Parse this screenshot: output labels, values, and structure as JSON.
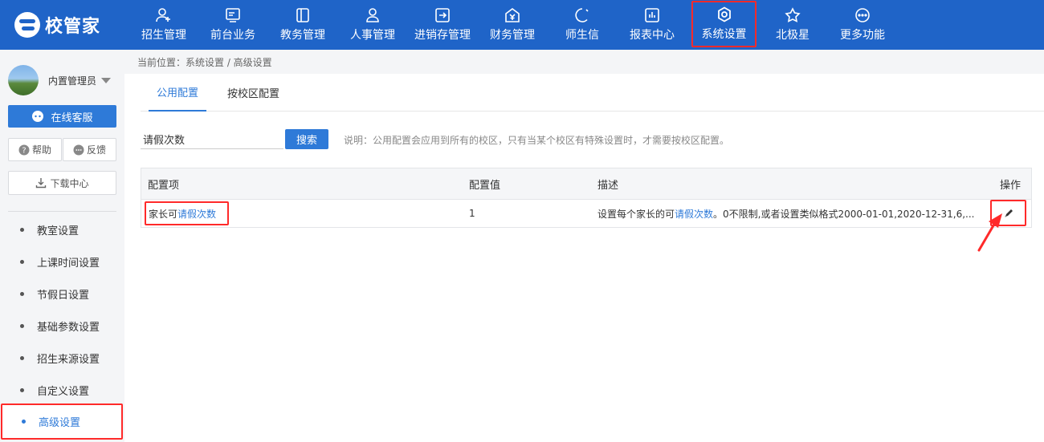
{
  "brand": {
    "name": "校管家"
  },
  "nav": [
    {
      "label": "招生管理",
      "icon": "user-add-icon"
    },
    {
      "label": "前台业务",
      "icon": "monitor-icon"
    },
    {
      "label": "教务管理",
      "icon": "book-icon"
    },
    {
      "label": "人事管理",
      "icon": "person-icon"
    },
    {
      "label": "进销存管理",
      "icon": "inventory-icon"
    },
    {
      "label": "财务管理",
      "icon": "finance-icon"
    },
    {
      "label": "师生信",
      "icon": "chat-icon"
    },
    {
      "label": "报表中心",
      "icon": "report-icon"
    },
    {
      "label": "系统设置",
      "icon": "settings-icon",
      "active": true
    },
    {
      "label": "北极星",
      "icon": "star-icon"
    },
    {
      "label": "更多功能",
      "icon": "more-icon"
    }
  ],
  "sidebar": {
    "username": "内置管理员",
    "service_label": "在线客服",
    "help_label": "帮助",
    "feedback_label": "反馈",
    "download_label": "下载中心",
    "menu": [
      {
        "label": "教室设置"
      },
      {
        "label": "上课时间设置"
      },
      {
        "label": "节假日设置"
      },
      {
        "label": "基础参数设置"
      },
      {
        "label": "招生来源设置"
      },
      {
        "label": "自定义设置"
      },
      {
        "label": "高级设置",
        "active": true
      }
    ]
  },
  "breadcrumb": "当前位置：系统设置 / 高级设置",
  "tabs": [
    {
      "label": "公用配置",
      "active": true
    },
    {
      "label": "按校区配置"
    }
  ],
  "search": {
    "value": "请假次数",
    "button_label": "搜索",
    "note": "说明：公用配置会应用到所有的校区，只有当某个校区有特殊设置时，才需要按校区配置。"
  },
  "table": {
    "headers": [
      "配置项",
      "配置值",
      "描述",
      "操作"
    ],
    "rows": [
      {
        "name_prefix": "家长可",
        "name_highlight": "请假次数",
        "value": "1",
        "desc_prefix": "设置每个家长的可",
        "desc_highlight": "请假次数",
        "desc_suffix": "。0不限制,或者设置类似格式2000-01-01,2020-12-31,6,..."
      }
    ]
  },
  "colors": {
    "topbar": "#1f64c8",
    "accent": "#2e7ad8",
    "highlight_box": "#ff2a2a"
  }
}
